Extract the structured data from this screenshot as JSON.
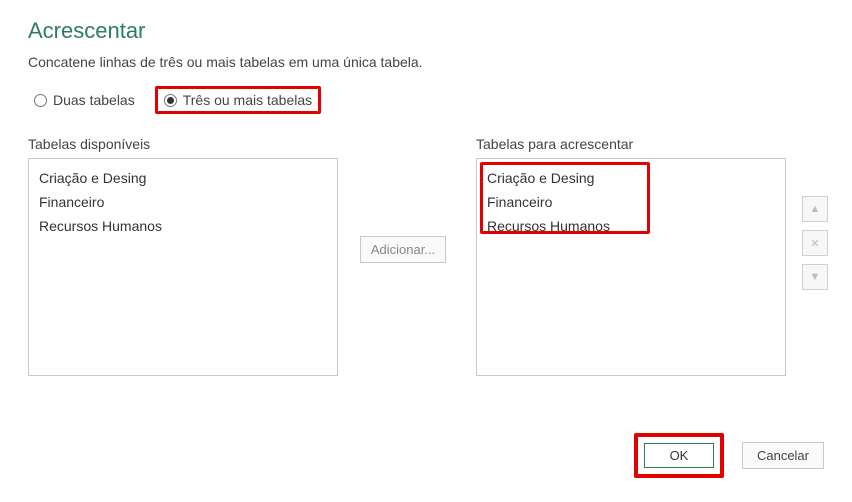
{
  "dialog": {
    "title": "Acrescentar",
    "subtitle": "Concatene linhas de três ou mais tabelas em uma única tabela."
  },
  "radios": {
    "two_tables": "Duas tabelas",
    "three_or_more": "Três ou mais tabelas",
    "selected": "three_or_more"
  },
  "available": {
    "label": "Tabelas disponíveis",
    "items": [
      "Criação e Desing",
      "Financeiro",
      "Recursos Humanos"
    ]
  },
  "to_append": {
    "label": "Tabelas para acrescentar",
    "items": [
      "Criação e Desing",
      "Financeiro",
      "Recursos Humanos"
    ]
  },
  "buttons": {
    "add": "Adicionar...",
    "ok": "OK",
    "cancel": "Cancelar"
  },
  "icons": {
    "up": "▲",
    "remove": "✕",
    "down": "▼"
  }
}
